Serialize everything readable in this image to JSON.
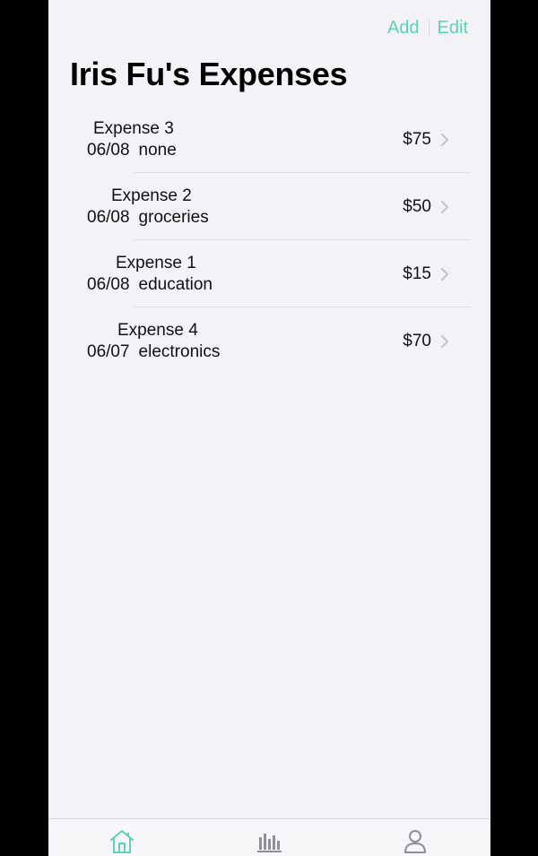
{
  "nav": {
    "add_label": "Add",
    "edit_label": "Edit"
  },
  "page": {
    "title": "Iris Fu's Expenses"
  },
  "expenses": [
    {
      "name": "Expense 3",
      "date": "06/08",
      "category": "none",
      "amount": "$75"
    },
    {
      "name": "Expense 2",
      "date": "06/08",
      "category": "groceries",
      "amount": "$50"
    },
    {
      "name": "Expense 1",
      "date": "06/08",
      "category": "education",
      "amount": "$15"
    },
    {
      "name": "Expense 4",
      "date": "06/07",
      "category": "electronics",
      "amount": "$70"
    }
  ],
  "tabbar": {
    "tabs": [
      {
        "icon": "house-icon",
        "selected": true
      },
      {
        "icon": "bar-chart-icon",
        "selected": false
      },
      {
        "icon": "person-icon",
        "selected": false
      }
    ]
  },
  "colors": {
    "accent": "#5ed0b6",
    "background": "#f2f2f7",
    "text": "#111111",
    "chevron": "#c4c4c7",
    "tab_inactive": "#8e8e93"
  }
}
